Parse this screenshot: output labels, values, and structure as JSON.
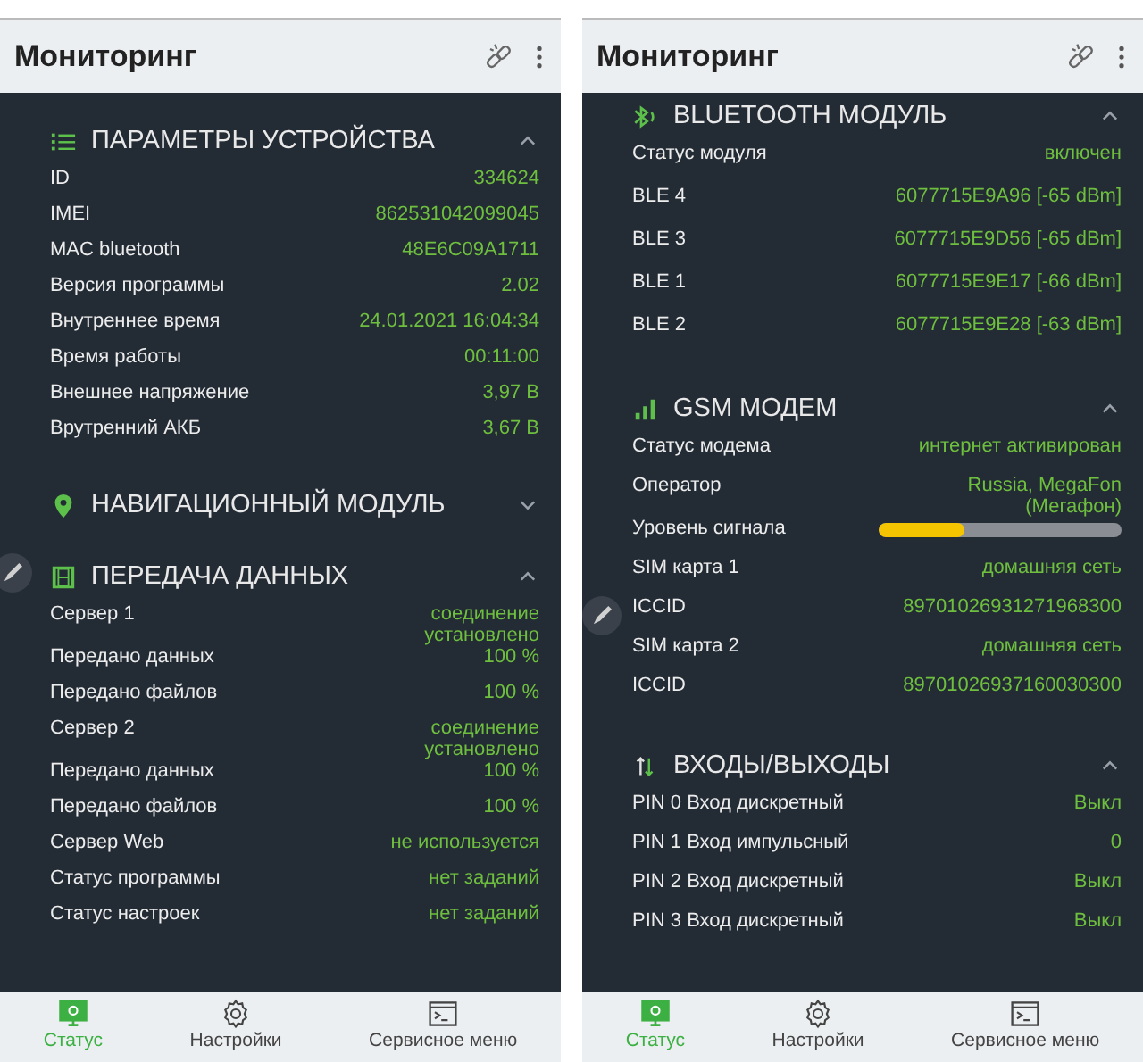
{
  "phones": [
    {
      "title": "Мониторинг",
      "sections": [
        {
          "kind": "list",
          "title": "ПАРАМЕТРЫ УСТРОЙСТВА",
          "expanded": true,
          "rows": [
            {
              "kind": "text",
              "label": "ID",
              "value": "334624"
            },
            {
              "kind": "text",
              "label": "IMEI",
              "value": "862531042099045"
            },
            {
              "kind": "text",
              "label": "MAC bluetooth",
              "value": "48E6C09A1711"
            },
            {
              "kind": "text",
              "label": "Версия программы",
              "value": "2.02"
            },
            {
              "kind": "text",
              "label": "Внутреннее время",
              "value": "24.01.2021 16:04:34"
            },
            {
              "kind": "text",
              "label": "Время работы",
              "value": "00:11:00"
            },
            {
              "kind": "text",
              "label": "Внешнее напряжение",
              "value": "3,97 В"
            },
            {
              "kind": "text",
              "label": "Врутренний АКБ",
              "value": "3,67 В"
            }
          ]
        },
        {
          "kind": "pin",
          "title": "НАВИГАЦИОННЫЙ МОДУЛЬ",
          "expanded": false
        },
        {
          "kind": "transfer",
          "title": "ПЕРЕДАЧА ДАННЫХ",
          "expanded": true,
          "rows": [
            {
              "kind": "text",
              "label": "Сервер 1",
              "value": "соединение установлено"
            },
            {
              "kind": "text",
              "label": "Передано данных",
              "value": "100 %"
            },
            {
              "kind": "text",
              "label": "Передано файлов",
              "value": "100 %"
            },
            {
              "kind": "text",
              "label": "Сервер 2",
              "value": "соединение установлено"
            },
            {
              "kind": "text",
              "label": "Передано данных",
              "value": "100 %"
            },
            {
              "kind": "text",
              "label": "Передано файлов",
              "value": "100 %"
            },
            {
              "kind": "text",
              "label": "Сервер Web",
              "value": "не используется"
            },
            {
              "kind": "text",
              "label": "Статус программы",
              "value": "нет заданий"
            },
            {
              "kind": "text",
              "label": "Статус настроек",
              "value": "нет заданий"
            }
          ]
        }
      ],
      "nav": [
        {
          "kind": "monitor",
          "label": "Статус",
          "selected": true
        },
        {
          "kind": "gear",
          "label": "Настройки",
          "selected": false
        },
        {
          "kind": "terminal",
          "label": "Сервисное меню",
          "selected": false
        }
      ]
    },
    {
      "title": "Мониторинг",
      "sections": [
        {
          "kind": "bluetooth",
          "title": "BLUETOOTH МОДУЛЬ",
          "expanded": true,
          "rows": [
            {
              "kind": "text",
              "label": "Статус модуля",
              "value": "включен"
            },
            {
              "kind": "text",
              "label": "BLE 4",
              "value": "6077715E9A96 [-65 dBm]"
            },
            {
              "kind": "text",
              "label": "BLE 3",
              "value": "6077715E9D56 [-65 dBm]"
            },
            {
              "kind": "text",
              "label": "BLE 1",
              "value": "6077715E9E17 [-66 dBm]"
            },
            {
              "kind": "text",
              "label": "BLE 2",
              "value": "6077715E9E28 [-63 dBm]"
            }
          ]
        },
        {
          "kind": "signal",
          "title": "GSM МОДЕМ",
          "expanded": true,
          "rows": [
            {
              "kind": "text",
              "label": "Статус модема",
              "value": "интернет активирован"
            },
            {
              "kind": "text",
              "label": "Оператор",
              "value": "Russia, MegaFon (Мегафон)"
            },
            {
              "kind": "bar",
              "label": "Уровень сигнала",
              "level": 0.35
            },
            {
              "kind": "text",
              "label": "SIM карта 1",
              "value": "домашняя сеть"
            },
            {
              "kind": "text",
              "label": "ICCID",
              "value": "89701026931271968300"
            },
            {
              "kind": "text",
              "label": "SIM карта 2",
              "value": "домашняя сеть"
            },
            {
              "kind": "text",
              "label": "ICCID",
              "value": "89701026937160030300"
            }
          ]
        },
        {
          "kind": "updown",
          "title": "ВХОДЫ/ВЫХОДЫ",
          "expanded": true,
          "rows": [
            {
              "kind": "text",
              "label": "PIN 0 Вход дискретный",
              "value": "Выкл"
            },
            {
              "kind": "text",
              "label": "PIN 1 Вход импульсный",
              "value": "0"
            },
            {
              "kind": "text",
              "label": "PIN 2 Вход дискретный",
              "value": "Выкл"
            },
            {
              "kind": "text",
              "label": "PIN 3 Вход дискретный",
              "value": "Выкл"
            }
          ]
        }
      ],
      "nav": [
        {
          "kind": "monitor",
          "label": "Статус",
          "selected": true
        },
        {
          "kind": "gear",
          "label": "Настройки",
          "selected": false
        },
        {
          "kind": "terminal",
          "label": "Сервисное меню",
          "selected": false
        }
      ]
    }
  ]
}
